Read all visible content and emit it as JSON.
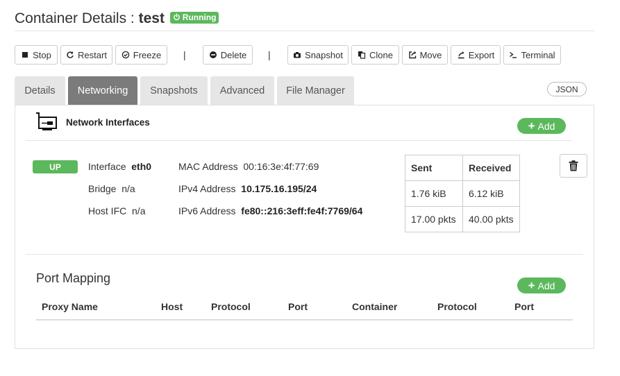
{
  "header": {
    "title_prefix": "Container Details : ",
    "container_name": "test",
    "status": "Running"
  },
  "toolbar": {
    "stop": "Stop",
    "restart": "Restart",
    "freeze": "Freeze",
    "sep": "|",
    "delete": "Delete",
    "snapshot": "Snapshot",
    "clone": "Clone",
    "move": "Move",
    "export": "Export",
    "terminal": "Terminal"
  },
  "tabs": [
    "Details",
    "Networking",
    "Snapshots",
    "Advanced",
    "File Manager"
  ],
  "active_tab": "Networking",
  "json_button": "JSON",
  "network": {
    "title": "Network Interfaces",
    "add_label": "Add",
    "interface": {
      "state": "UP",
      "interface_label": "Interface",
      "interface_value": "eth0",
      "bridge_label": "Bridge",
      "bridge_value": "n/a",
      "host_ifc_label": "Host IFC",
      "host_ifc_value": "n/a",
      "mac_label": "MAC Address",
      "mac_value": "00:16:3e:4f:77:69",
      "ipv4_label": "IPv4 Address",
      "ipv4_value": "10.175.16.195/24",
      "ipv6_label": "IPv6 Address",
      "ipv6_value": "fe80::216:3eff:fe4f:7769/64"
    },
    "traffic": {
      "headers": [
        "Sent",
        "Received"
      ],
      "rows": [
        [
          "1.76 kiB",
          "6.12 kiB"
        ],
        [
          "17.00 pkts",
          "40.00 pkts"
        ]
      ]
    }
  },
  "port_mapping": {
    "title": "Port Mapping",
    "add_label": "Add",
    "columns": [
      "Proxy Name",
      "Host",
      "Protocol",
      "Port",
      "Container",
      "Protocol",
      "Port"
    ]
  },
  "colors": {
    "accent_green": "#5cb85c",
    "active_tab": "#7b7b7b",
    "tab": "#e6e6e6"
  }
}
